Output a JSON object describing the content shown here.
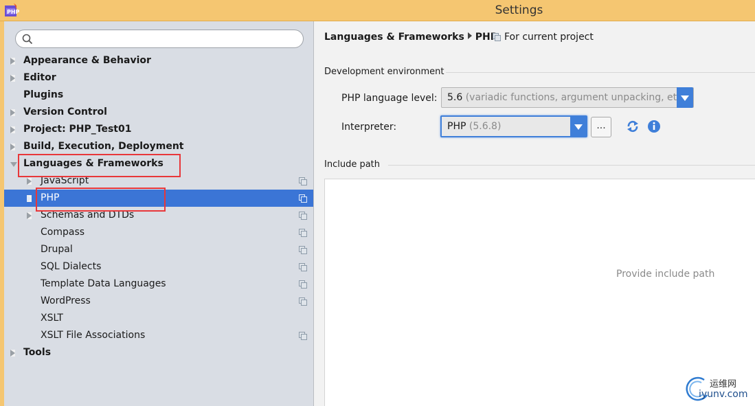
{
  "window": {
    "title": "Settings"
  },
  "search": {
    "placeholder": ""
  },
  "tree": {
    "appearance": "Appearance & Behavior",
    "editor": "Editor",
    "plugins": "Plugins",
    "version_control": "Version Control",
    "project": "Project: PHP_Test01",
    "build": "Build, Execution, Deployment",
    "languages": "Languages & Frameworks",
    "javascript": "JavaScript",
    "php": "PHP",
    "schemas": "Schemas and DTDs",
    "compass": "Compass",
    "drupal": "Drupal",
    "sql": "SQL Dialects",
    "template": "Template Data Languages",
    "wordpress": "WordPress",
    "xslt": "XSLT",
    "xslt_assoc": "XSLT File Associations",
    "tools": "Tools"
  },
  "breadcrumb": {
    "parent": "Languages & Frameworks",
    "current": "PHP"
  },
  "scope_label": "For current project",
  "dev_env": {
    "section_title": "Development environment",
    "php_level_label": "PHP language level:",
    "php_level_value": "5.6",
    "php_level_desc": "(variadic functions, argument unpacking, etc.)",
    "interpreter_label": "Interpreter:",
    "interpreter_value": "PHP",
    "interpreter_version": "(5.6.8)",
    "more_button": "..."
  },
  "include_path": {
    "section_title": "Include path",
    "placeholder": "Provide include path"
  },
  "watermark": {
    "line1": "运维网",
    "line2": "iyunv.com"
  },
  "colors": {
    "selection": "#3b75d6",
    "titlebar": "#f5c671",
    "highlight": "#e8373a"
  },
  "icons": [
    "php-app-icon",
    "search-icon",
    "copy-icon",
    "refresh-icon",
    "info-icon",
    "dropdown-arrow-icon"
  ]
}
